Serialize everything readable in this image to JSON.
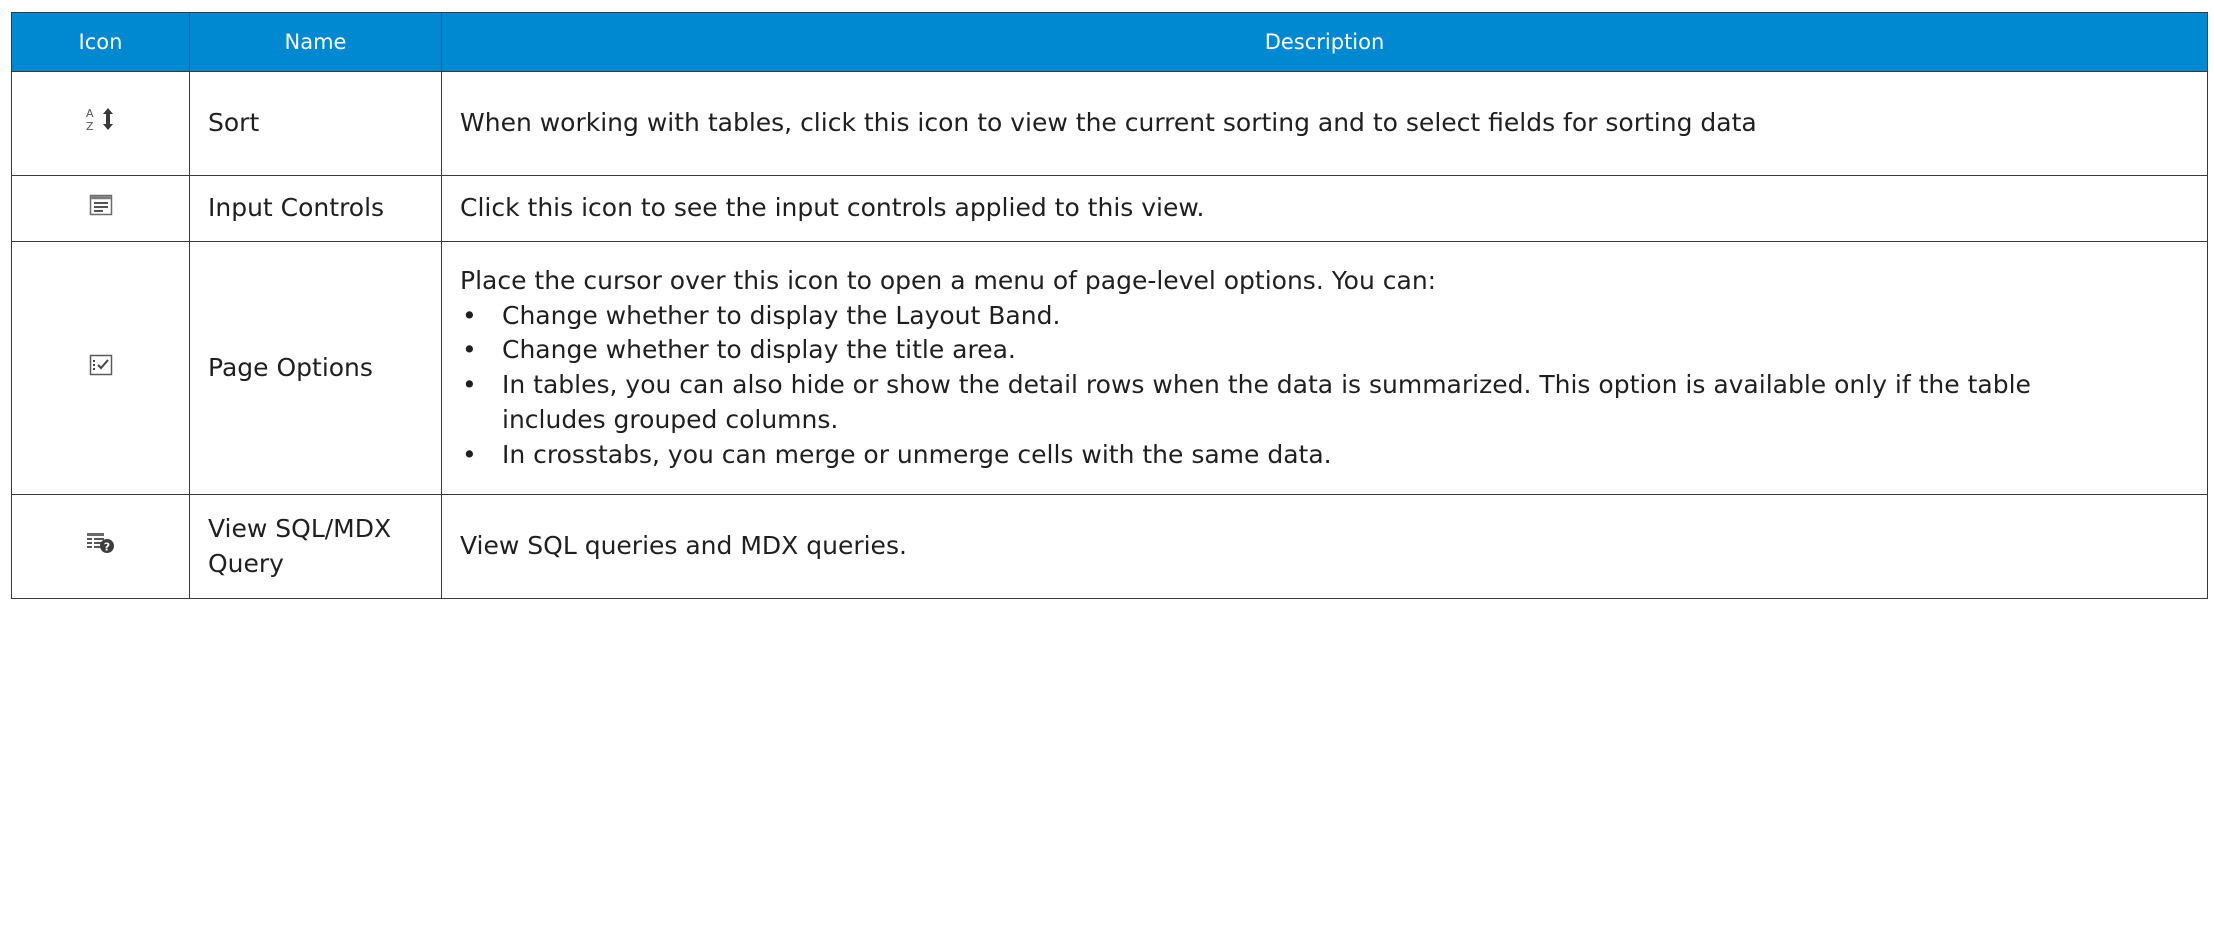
{
  "table": {
    "headers": {
      "icon": "Icon",
      "name": "Name",
      "description": "Description"
    },
    "rows": [
      {
        "icon": "sort-icon",
        "name": "Sort",
        "description": "When working with tables, click this icon to view the current sorting and to select fields for sorting data"
      },
      {
        "icon": "input-controls-icon",
        "name": "Input Controls",
        "description": "Click this icon to see the input controls applied to this view."
      },
      {
        "icon": "page-options-icon",
        "name": "Page Options",
        "description": "Place the cursor over this icon to open a menu of page-level options. You can:",
        "bullets": [
          "Change whether to display the Layout Band.",
          "Change whether to display the title area.",
          "In tables, you can also hide or show the detail rows when the data is summarized. This option is available only if the table includes grouped columns.",
          "In crosstabs, you can merge or unmerge cells with the same data."
        ]
      },
      {
        "icon": "view-sql-mdx-query-icon",
        "name": "View SQL/MDX Query",
        "description": "View SQL queries and MDX queries."
      }
    ]
  },
  "colors": {
    "header_background": "#0088d1",
    "header_text": "#ffffff",
    "border": "#3a3a3a"
  }
}
